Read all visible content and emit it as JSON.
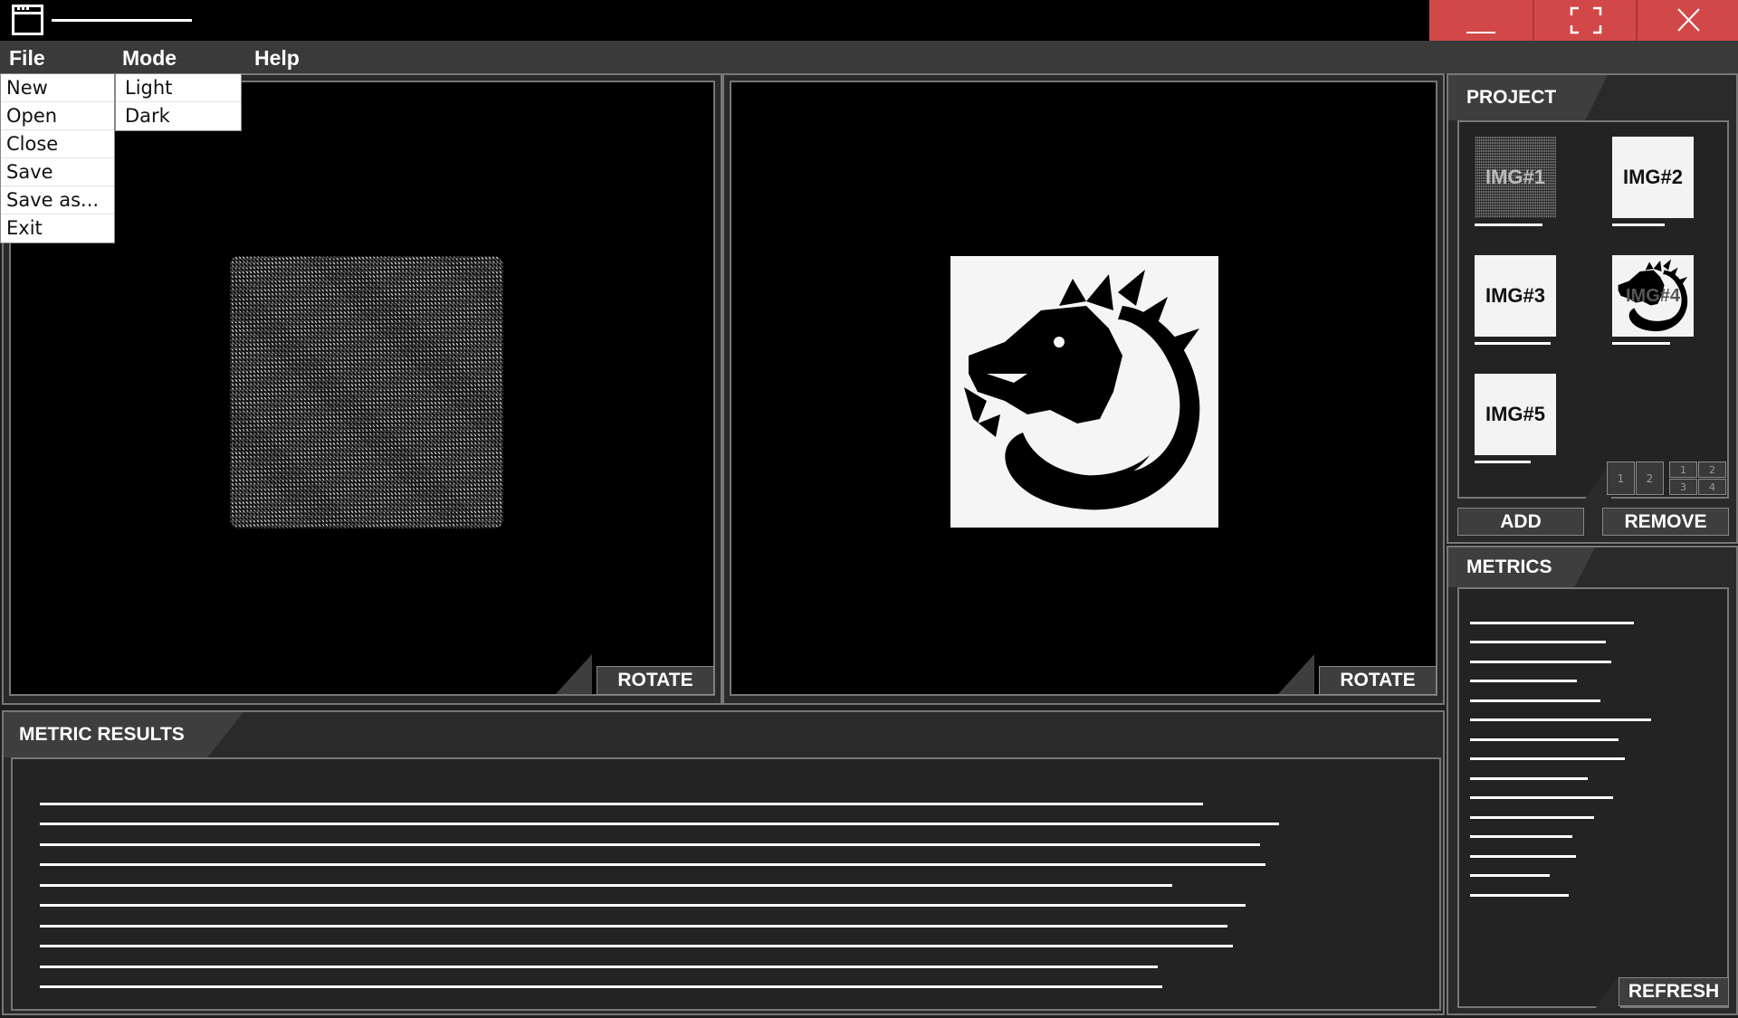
{
  "menubar": {
    "file": "File",
    "mode": "Mode",
    "help": "Help"
  },
  "file_menu": [
    "New",
    "Open",
    "Close",
    "Save",
    "Save as...",
    "Exit"
  ],
  "mode_menu": [
    "Light",
    "Dark"
  ],
  "viewers": {
    "left_rotate": "ROTATE",
    "right_rotate": "ROTATE"
  },
  "project": {
    "title": "PROJECT",
    "thumbnails": [
      {
        "label": "IMG#1",
        "style": "noise"
      },
      {
        "label": "IMG#2",
        "style": "plain"
      },
      {
        "label": "IMG#3",
        "style": "plain"
      },
      {
        "label": "IMG#4",
        "style": "dragon"
      },
      {
        "label": "IMG#5",
        "style": "plain"
      }
    ],
    "layout_single": [
      "1",
      "2"
    ],
    "layout_grid": [
      "1",
      "2",
      "3",
      "4"
    ],
    "add_label": "ADD",
    "remove_label": "REMOVE"
  },
  "metrics": {
    "title": "METRICS",
    "refresh_label": "REFRESH"
  },
  "metric_results": {
    "title": "METRIC RESULTS"
  },
  "colors": {
    "window_controls": "#d24848",
    "panel_background": "#2a2a2a",
    "panel_border": "#777777"
  }
}
